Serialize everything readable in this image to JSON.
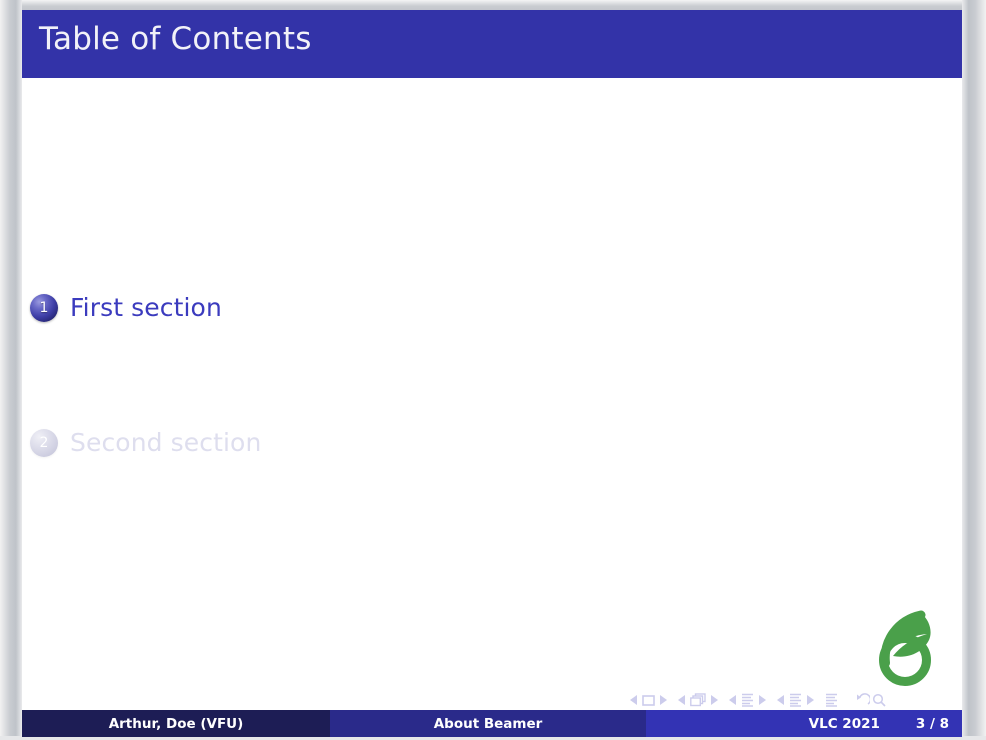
{
  "slide": {
    "title": "Table of Contents",
    "colors": {
      "title_bar": "#3333a8",
      "title_text": "#f2f2f8",
      "active_text": "#3b3bbe",
      "dim_text": "#dedeee",
      "footer_author_bg": "#1d1d55",
      "footer_title_bg": "#2a2a8a",
      "footer_meta_bg": "#3333b4",
      "logo_green": "#49a council"
    }
  },
  "toc": {
    "entries": [
      {
        "number": "1",
        "label": "First section",
        "state": "active"
      },
      {
        "number": "2",
        "label": "Second section",
        "state": "dim"
      }
    ]
  },
  "logo": {
    "name": "overleaf-logo",
    "color": "#4aa04a"
  },
  "navigation_symbols": {
    "groups": [
      {
        "name": "slide-navigation",
        "icons": [
          "prev-triangle-icon",
          "slide-square-icon",
          "next-triangle-icon"
        ]
      },
      {
        "name": "frame-navigation",
        "icons": [
          "prev-triangle-icon",
          "frames-stack-icon",
          "next-triangle-icon"
        ]
      },
      {
        "name": "subsection-navigation",
        "icons": [
          "prev-triangle-icon",
          "subsection-lines-icon",
          "next-triangle-icon"
        ]
      },
      {
        "name": "section-navigation",
        "icons": [
          "prev-triangle-icon",
          "section-lines-icon",
          "next-triangle-icon"
        ]
      },
      {
        "name": "presentation-navigation",
        "icons": [
          "presentation-lines-icon"
        ]
      },
      {
        "name": "back-find-navigation",
        "icons": [
          "back-arrow-icon",
          "find-magnifier-icon"
        ]
      }
    ]
  },
  "footer": {
    "author": "Arthur, Doe  (VFU)",
    "title": "About Beamer",
    "date": "VLC 2021",
    "page": "3 / 8"
  }
}
